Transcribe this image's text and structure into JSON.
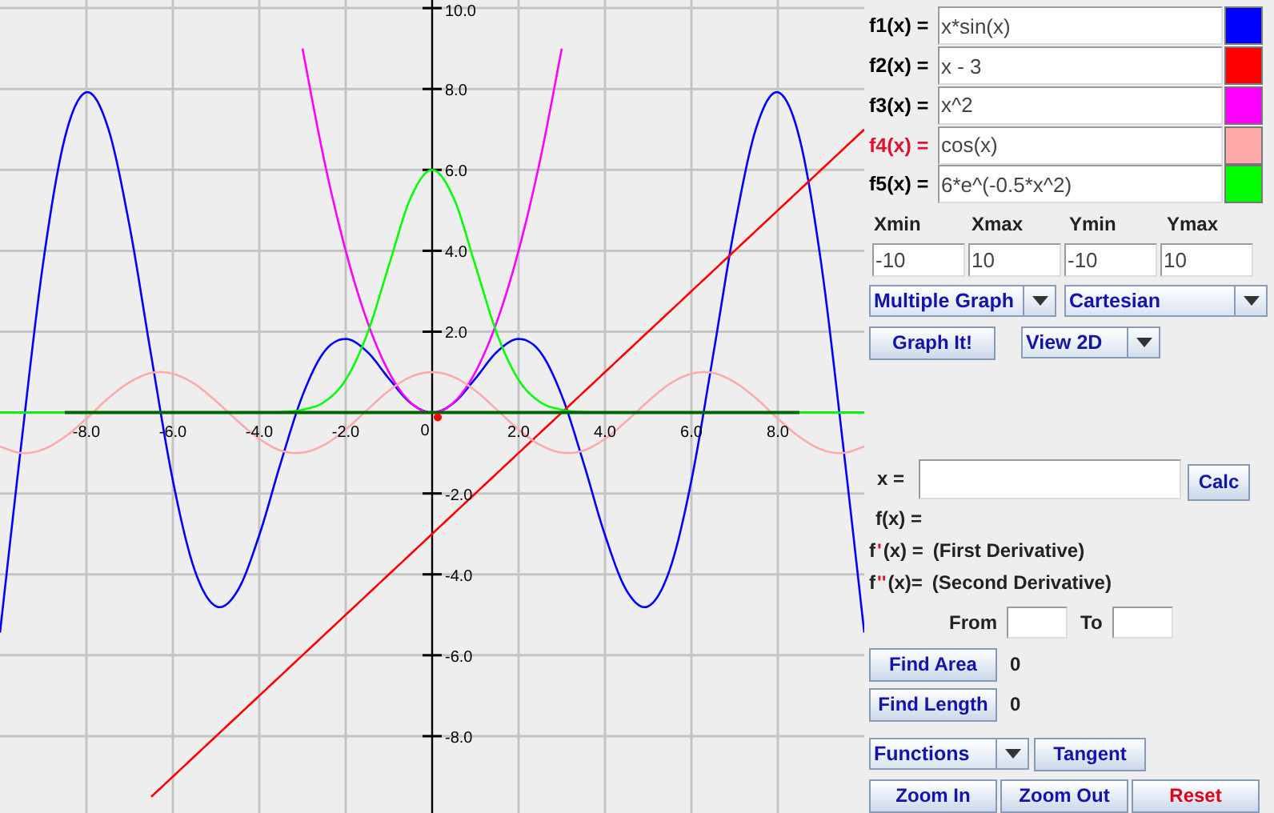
{
  "graph": {
    "chart_data": {
      "type": "line",
      "x": [
        -10,
        -9.5,
        -9,
        -8.5,
        -8,
        -7.5,
        -7,
        -6.5,
        -6,
        -5.5,
        -5,
        -4.5,
        -4,
        -3.5,
        -3,
        -2.5,
        -2,
        -1.5,
        -1,
        -0.5,
        0,
        0.5,
        1,
        1.5,
        2,
        2.5,
        3,
        3.5,
        4,
        4.5,
        5,
        5.5,
        6,
        6.5,
        7,
        7.5,
        8,
        8.5,
        9,
        9.5,
        10
      ],
      "series": [
        {
          "color": "#0000ff",
          "values": [
            -5.44,
            -0.71,
            3.71,
            6.79,
            7.92,
            7.04,
            4.6,
            1.4,
            -1.68,
            -3.88,
            -4.79,
            -4.4,
            -3.03,
            -1.23,
            0.42,
            1.5,
            1.82,
            1.5,
            0.84,
            0.24,
            0,
            0.24,
            0.84,
            1.5,
            1.82,
            1.5,
            0.42,
            -1.23,
            -3.03,
            -4.4,
            -4.79,
            -3.88,
            -1.68,
            1.4,
            4.6,
            7.04,
            7.92,
            6.79,
            3.71,
            -0.71,
            -5.44
          ]
        },
        {
          "color": "#ff0000",
          "values": [
            null,
            null,
            null,
            null,
            null,
            null,
            null,
            -9.5,
            -9,
            -8.5,
            -8,
            -7.5,
            -7,
            -6.5,
            -6,
            -5.5,
            -5,
            -4.5,
            -4,
            -3.5,
            -3,
            -2.5,
            -2,
            -1.5,
            -1,
            -0.5,
            0,
            0.5,
            1,
            1.5,
            2,
            2.5,
            3,
            3.5,
            4,
            4.5,
            5,
            5.5,
            6,
            6.5,
            7
          ]
        },
        {
          "color": "#ff00ff",
          "values": [
            null,
            null,
            null,
            null,
            null,
            null,
            null,
            null,
            null,
            null,
            null,
            null,
            null,
            null,
            9,
            6.25,
            4,
            2.25,
            1,
            0.25,
            0,
            0.25,
            1,
            2.25,
            4,
            6.25,
            9,
            null,
            null,
            null,
            null,
            null,
            null,
            null,
            null,
            null,
            null,
            null,
            null,
            null,
            null
          ]
        },
        {
          "color": "#ffaaaa",
          "values": [
            -0.84,
            -1,
            -0.91,
            -0.6,
            -0.15,
            0.35,
            0.75,
            0.98,
            0.96,
            0.71,
            0.28,
            -0.21,
            -0.65,
            -0.94,
            -0.99,
            -0.8,
            -0.42,
            0.07,
            0.54,
            0.88,
            1,
            0.88,
            0.54,
            0.07,
            -0.42,
            -0.8,
            -0.99,
            -0.94,
            -0.65,
            -0.21,
            0.28,
            0.71,
            0.96,
            0.98,
            0.75,
            0.35,
            -0.15,
            -0.6,
            -0.91,
            -1,
            -0.84
          ]
        },
        {
          "color": "#00ff00",
          "values": [
            0,
            0,
            0,
            0,
            0,
            0,
            0,
            0,
            0,
            0,
            0,
            0,
            0,
            0.01,
            0.07,
            0.26,
            0.81,
            1.95,
            3.64,
            5.3,
            6,
            5.3,
            3.64,
            1.95,
            0.81,
            0.26,
            0.07,
            0.01,
            0,
            0,
            0,
            0,
            0,
            0,
            0,
            0,
            0,
            0,
            0,
            0,
            0
          ]
        },
        {
          "color": "#006400",
          "values": [
            null,
            null,
            null,
            0,
            0,
            0,
            0,
            0,
            0,
            0,
            0,
            0,
            0,
            0,
            0,
            0,
            0,
            0,
            0,
            0,
            0,
            0,
            0,
            0,
            0,
            0,
            0,
            0,
            0,
            0,
            0,
            0,
            0,
            0,
            0,
            0,
            0,
            0,
            null,
            null,
            null
          ]
        }
      ],
      "xlim": [
        -10,
        10
      ],
      "ylim": [
        -9.9,
        10.2
      ],
      "grid": true,
      "xticks": [
        {
          "value": -8,
          "label": "-8.0"
        },
        {
          "value": -6,
          "label": "-6.0"
        },
        {
          "value": -4,
          "label": "-4.0"
        },
        {
          "value": -2,
          "label": "-2.0"
        },
        {
          "value": 0,
          "label": "0"
        },
        {
          "value": 2,
          "label": "2.0"
        },
        {
          "value": 4,
          "label": "4.0"
        },
        {
          "value": 6,
          "label": "6.0"
        },
        {
          "value": 8,
          "label": "8.0"
        }
      ],
      "yticks": [
        {
          "value": 10,
          "label": "10.0"
        },
        {
          "value": 8,
          "label": "8.0"
        },
        {
          "value": 6,
          "label": "6.0"
        },
        {
          "value": 4,
          "label": "4.0"
        },
        {
          "value": 2,
          "label": "2.0"
        },
        {
          "value": -2,
          "label": "-2.0"
        },
        {
          "value": -4,
          "label": "-4.0"
        },
        {
          "value": -6,
          "label": "-6.0"
        },
        {
          "value": -8,
          "label": "-8.0"
        }
      ]
    }
  },
  "functions": [
    {
      "label": "f1(x) =",
      "expression": "x*sin(x)",
      "color": "#0000ff",
      "selected": false
    },
    {
      "label": "f2(x) =",
      "expression": "x - 3",
      "color": "#ff0000",
      "selected": false
    },
    {
      "label": "f3(x) =",
      "expression": "x^2",
      "color": "#ff00ff",
      "selected": false
    },
    {
      "label": "f4(x) =",
      "expression": "cos(x)",
      "color": "#ffaaaa",
      "selected": true
    },
    {
      "label": "f5(x) =",
      "expression": "6*e^(-0.5*x^2)",
      "color": "#00ff00",
      "selected": false
    }
  ],
  "range": [
    {
      "label": "Xmin",
      "value": "-10"
    },
    {
      "label": "Xmax",
      "value": "10"
    },
    {
      "label": "Ymin",
      "value": "-10"
    },
    {
      "label": "Ymax",
      "value": "10"
    }
  ],
  "mode_selects": [
    {
      "value": "Multiple Graph"
    },
    {
      "value": "Cartesian"
    }
  ],
  "graph_button": "Graph It!",
  "view_select": {
    "value": "View 2D"
  },
  "evaluate": {
    "label": "x =",
    "button": "Calc"
  },
  "results": [
    {
      "label": "f(x) ="
    },
    {
      "label": "f",
      "prime": "'",
      "rest": "(x) =",
      "description": "(First Derivative)"
    },
    {
      "label": "f",
      "prime": "''",
      "rest": "(x)=",
      "description": "(Second Derivative)"
    }
  ],
  "interval": {
    "from_label": "From",
    "to_label": "To"
  },
  "measures": [
    {
      "button": "Find Area",
      "value": "0"
    },
    {
      "button": "Find Length",
      "value": "0"
    }
  ],
  "tools": {
    "select": "Functions",
    "button": "Tangent"
  },
  "bottom_buttons": [
    {
      "label": "Zoom In",
      "kind": "normal"
    },
    {
      "label": "Zoom Out",
      "kind": "normal"
    },
    {
      "label": "Reset",
      "kind": "danger"
    }
  ]
}
